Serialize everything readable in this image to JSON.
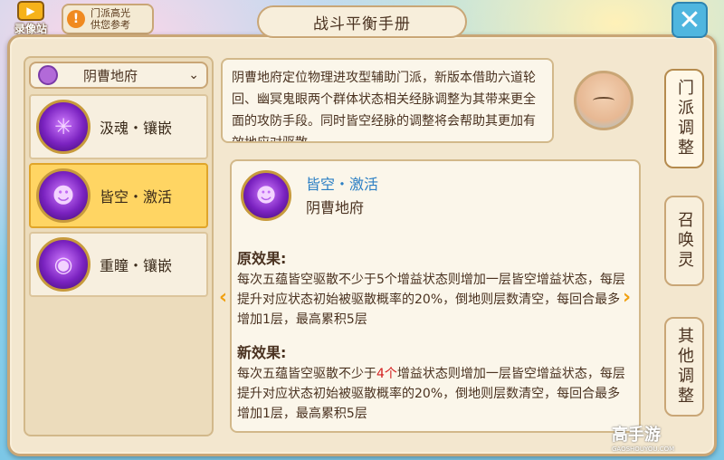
{
  "top_buttons": {
    "record_label": "录像站",
    "highlight_line1": "门派高光",
    "highlight_line2": "供您参考"
  },
  "title": "战斗平衡手册",
  "close_icon": "✕",
  "sect_dropdown": {
    "selected": "阴曹地府",
    "icon": "sect-emblem-icon"
  },
  "skills": [
    {
      "label": "汲魂・镶嵌",
      "icon": "spider-web-icon",
      "active": false
    },
    {
      "label": "皆空・激活",
      "icon": "demon-mask-icon",
      "active": true
    },
    {
      "label": "重瞳・镶嵌",
      "icon": "eye-swirl-icon",
      "active": false
    }
  ],
  "intro": "阴曹地府定位物理进攻型辅助门派，新版本借助六道轮回、幽冥鬼眼两个群体状态相关经脉调整为其带来更全面的攻防手段。同时皆空经脉的调整将会帮助其更加有效地应对驱散",
  "side_tabs": [
    {
      "label": "门派调整",
      "active": true
    },
    {
      "label": "召唤灵",
      "active": false
    },
    {
      "label": "其他调整",
      "active": false
    }
  ],
  "detail": {
    "name": "皆空・激活",
    "sect": "阴曹地府",
    "original_title": "原效果:",
    "original_text": "每次五蕴皆空驱散不少于5个增益状态则增加一层皆空增益状态，每层提升对应状态初始被驱散概率的20%，倒地则层数清空，每回合最多增加1层，最高累积5层",
    "new_title": "新效果:",
    "new_text_before": "每次五蕴皆空驱散不少于",
    "new_text_highlight": "4个",
    "new_text_after": "增益状态则增加一层皆空增益状态，每层提升对应状态初始被驱散概率的20%，倒地则层数清空，每回合最多增加1层，最高累积5层"
  },
  "nav": {
    "prev": "‹",
    "next": "›"
  },
  "watermark": {
    "main": "高手游",
    "sub": "GAOSHOUYOU.COM"
  },
  "colors": {
    "accent_gold": "#f0a010",
    "skill_name_blue": "#2b7fc4",
    "highlight_red": "#d21f1f",
    "active_row": "#ffd563"
  }
}
